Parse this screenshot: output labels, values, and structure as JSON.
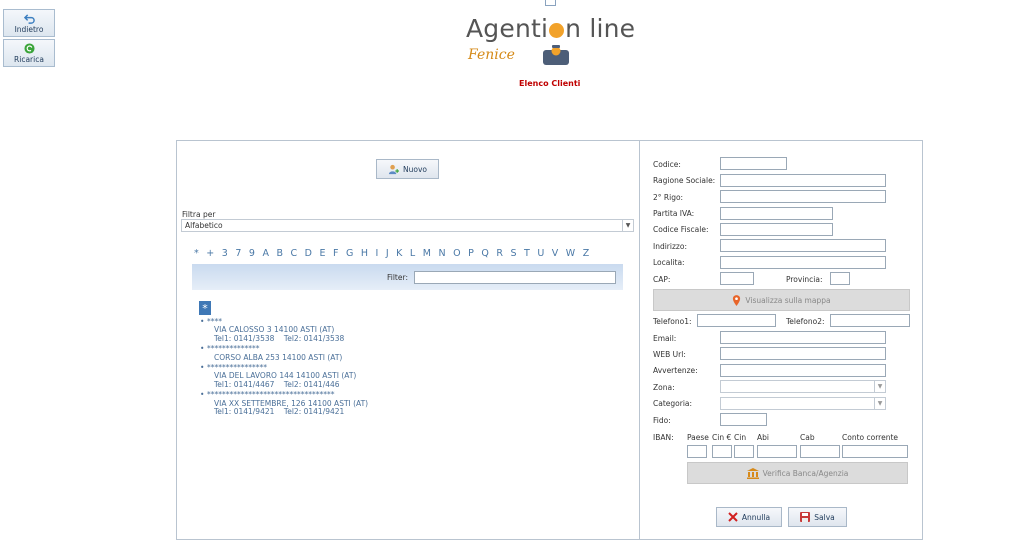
{
  "toolbar": {
    "back_label": "Indietro",
    "reload_label": "Ricarica"
  },
  "header": {
    "logo_part1": "Agenti",
    "logo_part2": "n line",
    "logo_sub": "Fenice",
    "title": "Elenco Clienti"
  },
  "left": {
    "new_label": "Nuovo",
    "filter_by_label": "Filtra per",
    "filter_by_value": "Alfabetico",
    "letters": "* + 3 7 9 A B C D E F G H I J K L M N O P Q R S T U V W Z",
    "filter_label": "Filter:",
    "group_badge": "*",
    "clients": [
      {
        "name": "****",
        "address": "VIA CALOSSO 3 14100 ASTI (AT)",
        "phones": "Tel1: 0141/3538    Tel2: 0141/3538"
      },
      {
        "name": "**************",
        "address": "CORSO ALBA 253 14100 ASTI (AT)",
        "phones": ""
      },
      {
        "name": "****************",
        "address": "VIA DEL LAVORO 144 14100 ASTI (AT)",
        "phones": "Tel1: 0141/4467    Tel2: 0141/446"
      },
      {
        "name": "**********************************",
        "address": "VIA XX SETTEMBRE, 126 14100 ASTI (AT)",
        "phones": "Tel1: 0141/9421    Tel2: 0141/9421"
      }
    ]
  },
  "form": {
    "codice": "Codice:",
    "ragione_sociale": "Ragione Sociale:",
    "secondo_rigo": "2° Rigo:",
    "partita_iva": "Partita IVA:",
    "codice_fiscale": "Codice Fiscale:",
    "indirizzo": "Indirizzo:",
    "localita": "Localita:",
    "cap": "CAP:",
    "provincia": "Provincia:",
    "map_button": "Visualizza sulla mappa",
    "telefono1": "Telefono1:",
    "telefono2": "Telefono2:",
    "email": "Email:",
    "web_url": "WEB Url:",
    "avvertenze": "Avvertenze:",
    "zona": "Zona:",
    "categoria": "Categoria:",
    "fido": "Fido:",
    "iban": "IBAN:",
    "iban_cols": {
      "paese": "Paese",
      "cin_eu": "Cin €",
      "cin": "Cin",
      "abi": "Abi",
      "cab": "Cab",
      "conto": "Conto corrente"
    },
    "verify_button": "Verifica Banca/Agenzia",
    "cancel_button": "Annulla",
    "save_button": "Salva"
  },
  "colors": {
    "title": "#c00000",
    "accent": "#f2a22a",
    "link": "#4a78a6"
  }
}
